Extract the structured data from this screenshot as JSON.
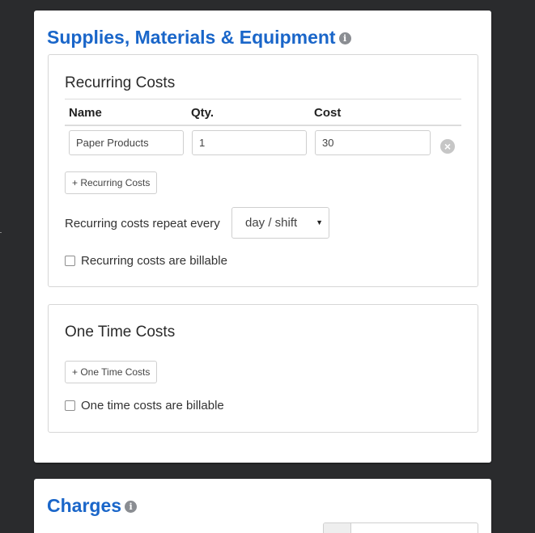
{
  "supplies_card": {
    "title": "Supplies, Materials & Equipment",
    "info_icon": "info-icon",
    "recurring": {
      "title": "Recurring Costs",
      "columns": [
        "Name",
        "Qty.",
        "Cost"
      ],
      "rows": [
        {
          "name": "Paper Products",
          "qty": "1",
          "cost": "30"
        }
      ],
      "add_button": "+ Recurring Costs",
      "repeat_label": "Recurring costs repeat every",
      "repeat_value": "day / shift",
      "billable_label": "Recurring costs are billable",
      "billable_checked": false
    },
    "one_time": {
      "title": "One Time Costs",
      "add_button": "+ One Time Costs",
      "billable_label": "One time costs are billable",
      "billable_checked": false
    }
  },
  "charges_card": {
    "title": "Charges",
    "info_icon": "info-icon"
  },
  "colors": {
    "background": "#2a2b2d",
    "title_blue": "#1a66c9",
    "card": "#ffffff"
  }
}
